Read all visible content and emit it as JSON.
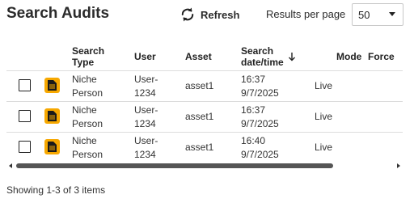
{
  "page": {
    "title": "Search Audits"
  },
  "toolbar": {
    "refresh_label": "Refresh",
    "refresh_icon": "refresh-icon",
    "results_per_page_label": "Results per page",
    "results_per_page_value": "50"
  },
  "table": {
    "columns": {
      "search_type_1": "Search",
      "search_type_2": "Type",
      "user": "User",
      "asset": "Asset",
      "datetime_1": "Search",
      "datetime_2": "date/time",
      "mode": "Mode",
      "force": "Force"
    },
    "sorted_column": "Search date/time",
    "row_icon": "document-icon",
    "accent_color": "#f7a800",
    "rows": [
      {
        "type_1": "Niche",
        "type_2": "Person",
        "user_1": "User-",
        "user_2": "1234",
        "asset": "asset1",
        "time": "16:37",
        "date": "9/7/2025",
        "mode": "Live",
        "force": ""
      },
      {
        "type_1": "Niche",
        "type_2": "Person",
        "user_1": "User-",
        "user_2": "1234",
        "asset": "asset1",
        "time": "16:37",
        "date": "9/7/2025",
        "mode": "Live",
        "force": ""
      },
      {
        "type_1": "Niche",
        "type_2": "Person",
        "user_1": "User-",
        "user_2": "1234",
        "asset": "asset1",
        "time": "16:40",
        "date": "9/7/2025",
        "mode": "Live",
        "force": ""
      }
    ]
  },
  "footer": {
    "summary": "Showing 1-3 of 3 items"
  }
}
